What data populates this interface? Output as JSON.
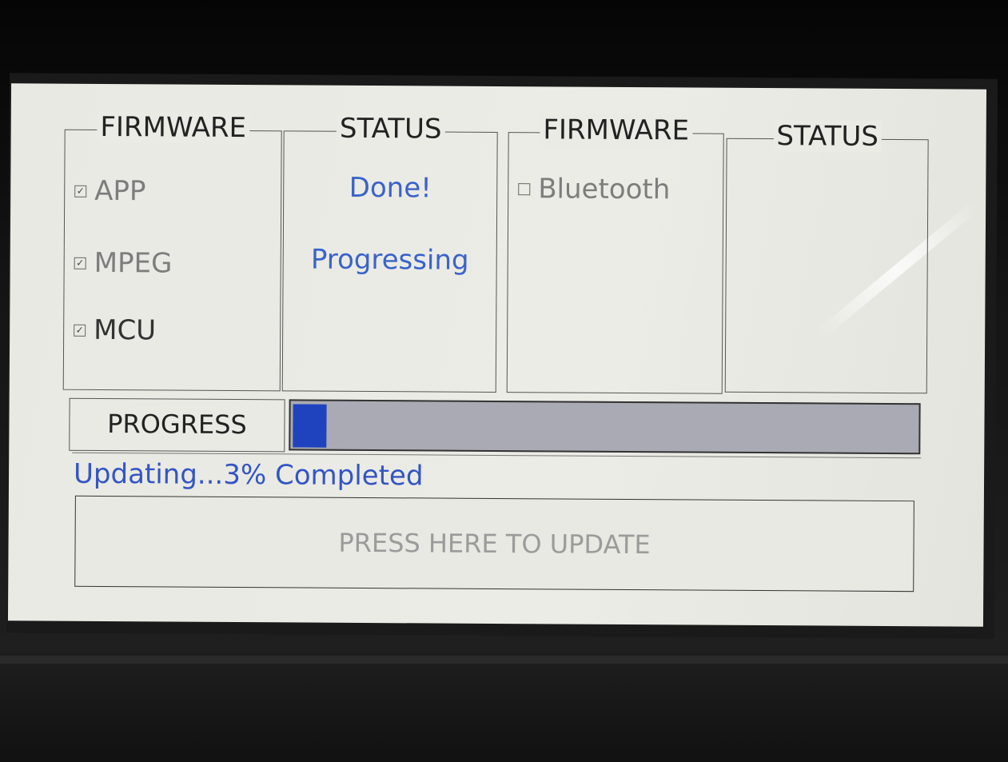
{
  "panels": [
    {
      "title": "FIRMWARE",
      "items": [
        {
          "label": "APP",
          "checked": true
        },
        {
          "label": "MPEG",
          "checked": true
        },
        {
          "label": "MCU",
          "checked": true
        }
      ]
    },
    {
      "title": "STATUS",
      "statuses": [
        "Done!",
        "Progressing"
      ]
    },
    {
      "title": "FIRMWARE",
      "items": [
        {
          "label": "Bluetooth",
          "checked": false
        }
      ]
    },
    {
      "title": "STATUS",
      "statuses": []
    }
  ],
  "progress": {
    "label": "PROGRESS",
    "percent": 3
  },
  "update_status_text": "Updating...3% Completed",
  "update_button_label": "PRESS HERE TO UPDATE",
  "colors": {
    "status_blue": "#3a63c9",
    "progress_fill": "#1f43bf",
    "progress_track": "#a9aab3"
  }
}
